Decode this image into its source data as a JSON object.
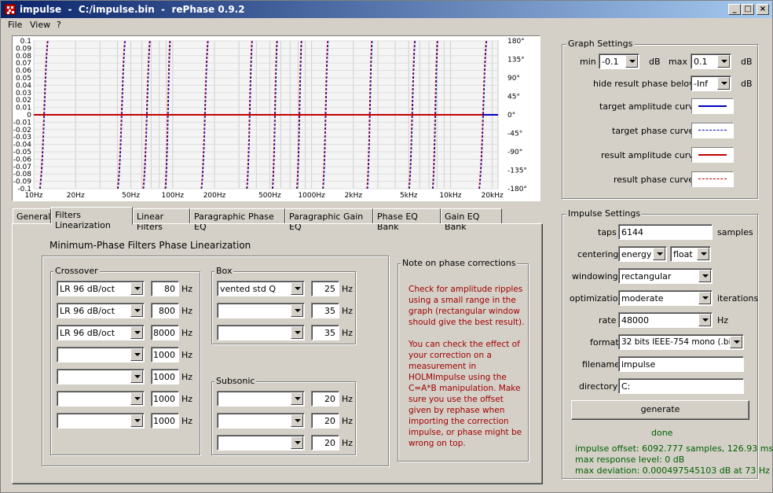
{
  "window": {
    "title": "impulse  -  C:/impulse.bin  -  rePhase 0.9.2"
  },
  "menu": [
    "File",
    "View",
    "?"
  ],
  "graph": {
    "y_ticks": [
      "0.1",
      "0.09",
      "0.08",
      "0.07",
      "0.06",
      "0.05",
      "0.04",
      "0.03",
      "0.02",
      "0.01",
      "0",
      "-0.01",
      "-0.02",
      "-0.03",
      "-0.04",
      "-0.05",
      "-0.06",
      "-0.07",
      "-0.08",
      "-0.09",
      "-0.1"
    ],
    "phase_ticks": [
      "180°",
      "135°",
      "90°",
      "45°",
      "0°",
      "-45°",
      "-90°",
      "-135°",
      "-180°"
    ],
    "x_ticks": [
      "10Hz",
      "20Hz",
      "50Hz",
      "100Hz",
      "200Hz",
      "500Hz",
      "1000Hz",
      "2kHz",
      "5kHz",
      "10kHz",
      "20kHz"
    ]
  },
  "chart_data": {
    "type": "line",
    "x_scale": "log",
    "xlim": [
      10,
      22000
    ],
    "ylim": [
      -0.1,
      0.1
    ],
    "y2lim": [
      -180,
      180
    ],
    "grid": true,
    "series": [
      {
        "values": [
          [
            10,
            0
          ],
          [
            22000,
            0
          ]
        ]
      }
    ]
  },
  "graph_settings": {
    "legend": "Graph Settings",
    "min_label": "min",
    "min_value": "-0.1",
    "unit_db": "dB",
    "max_label": "max",
    "max_value": "0.1",
    "hide_label": "hide result phase below",
    "hide_value": "-Inf",
    "curves": [
      {
        "label": "target amplitude curve",
        "color": "#0000c0",
        "style": "solid"
      },
      {
        "label": "target phase curve",
        "color": "#0000c0",
        "style": "dashed"
      },
      {
        "label": "result amplitude curve",
        "color": "#c00000",
        "style": "solid"
      },
      {
        "label": "result phase curve",
        "color": "#c00000",
        "style": "dashed"
      }
    ]
  },
  "tabs": [
    "General",
    "Filters Linearization",
    "Linear Filters",
    "Paragraphic Phase EQ",
    "Paragraphic Gain EQ",
    "Phase EQ Bank",
    "Gain EQ Bank"
  ],
  "linearization": {
    "heading": "Minimum-Phase Filters Phase Linearization",
    "hz": "Hz",
    "crossover": {
      "legend": "Crossover",
      "rows": [
        {
          "type": "LR  96 dB/oct",
          "freq": "80"
        },
        {
          "type": "LR  96 dB/oct",
          "freq": "800"
        },
        {
          "type": "LR  96 dB/oct",
          "freq": "8000"
        },
        {
          "type": "",
          "freq": "1000"
        },
        {
          "type": "",
          "freq": "1000"
        },
        {
          "type": "",
          "freq": "1000"
        },
        {
          "type": "",
          "freq": "1000"
        },
        {
          "type": "",
          "freq": "1000"
        }
      ]
    },
    "box": {
      "legend": "Box",
      "rows": [
        {
          "type": "vented std Q",
          "freq": "25"
        },
        {
          "type": "",
          "freq": "35"
        },
        {
          "type": "",
          "freq": "35"
        }
      ]
    },
    "subsonic": {
      "legend": "Subsonic",
      "rows": [
        {
          "type": "",
          "freq": "20"
        },
        {
          "type": "",
          "freq": "20"
        },
        {
          "type": "",
          "freq": "20"
        }
      ]
    },
    "note": {
      "legend": "Note on phase corrections",
      "lines": [
        "Check for amplitude ripples",
        "using a small range in the",
        "graph (rectangular window",
        "should give the best result).",
        "",
        "You can check the effect of",
        "your correction on a",
        "measurement in",
        "HOLMImpulse using the",
        "C=A*B manipulation. Make",
        "sure you use the offset",
        "given by rephase when",
        "importing the correction",
        "impulse, or phase might be",
        "wrong on top."
      ]
    }
  },
  "impulse_settings": {
    "legend": "Impulse Settings",
    "taps_label": "taps",
    "taps_value": "6144",
    "taps_unit": "samples",
    "centering_label": "centering",
    "centering_value": "energy",
    "centering_value2": "float",
    "windowing_label": "windowing",
    "windowing_value": "rectangular",
    "optimization_label": "optimization",
    "optimization_value": "moderate",
    "optimization_unit": "iterations",
    "rate_label": "rate",
    "rate_value": "48000",
    "rate_unit": "Hz",
    "format_label": "format",
    "format_value": "32 bits IEEE-754 mono (.bin)",
    "filename_label": "filename",
    "filename_value": "impulse",
    "directory_label": "directory",
    "directory_value": "C:",
    "generate_label": "generate",
    "status": "done",
    "info": [
      "impulse offset: 6092.777 samples, 126.93 ms",
      "max response level: 0 dB",
      "max deviation: 0.000497545103 dB at 73 Hz"
    ]
  }
}
